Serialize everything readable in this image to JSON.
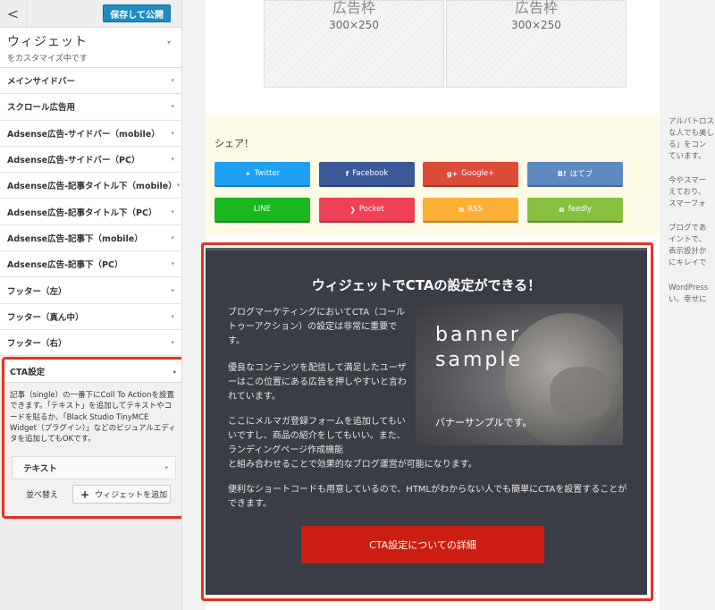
{
  "panel": {
    "back_label": "<",
    "publish_label": "保存して公開",
    "title": "ウィジェット",
    "subtitle": "をカスタマイズ中です",
    "arrow": "▾",
    "sections": [
      "メインサイドバー",
      "スクロール広告用",
      "Adsense広告-サイドバー（mobile）",
      "Adsense広告-サイドバー（PC）",
      "Adsense広告-記事タイトル下（mobile）",
      "Adsense広告-記事タイトル下（PC）",
      "Adsense広告-記事下（mobile）",
      "Adsense広告-記事下（PC）",
      "フッター（左）",
      "フッター（真ん中）",
      "フッター（右）"
    ],
    "cta": {
      "title": "CTA設定",
      "arrow_up": "▴",
      "description": "記事（single）の一番下にColl To Actionを設置できます。「テキスト」を追加してテキストやコードを貼るか、「Black Studio TinyMCE Widget（プラグイン）」などのビジュアルエディタを追加してもOKです。",
      "widget_label": "テキスト",
      "reorder_label": "並べ替え",
      "add_widget_label": "ウィジェットを追加",
      "add_icon": "+"
    }
  },
  "preview": {
    "ads": [
      {
        "label": "広告枠",
        "size": "300×250"
      },
      {
        "label": "広告枠",
        "size": "300×250"
      }
    ],
    "share": {
      "title": "シェア！",
      "buttons": [
        {
          "label": "Twitter",
          "icon": "bird-icon",
          "glyph": "✦",
          "color": "#1ea1f2"
        },
        {
          "label": "Facebook",
          "icon": "f-icon",
          "glyph": "f",
          "color": "#3b5998"
        },
        {
          "label": "Google+",
          "icon": "gplus-icon",
          "glyph": "g+",
          "color": "#dd4b39"
        },
        {
          "label": "はてブ",
          "icon": "b-icon",
          "glyph": "B!",
          "color": "#5d8ac1"
        },
        {
          "label": "LINE",
          "icon": "line-icon",
          "glyph": "",
          "color": "#1bb71f"
        },
        {
          "label": "Pocket",
          "icon": "pocket-icon",
          "glyph": "❯",
          "color": "#ee4056"
        },
        {
          "label": "RSS",
          "icon": "rss-icon",
          "glyph": "⋒",
          "color": "#fbb035"
        },
        {
          "label": "feedly",
          "icon": "feedly-icon",
          "glyph": "⋒",
          "color": "#87c040"
        }
      ]
    },
    "cta": {
      "title": "ウィジェットでCTAの設定ができる！",
      "p1": "ブログマーケティングにおいてCTA（コールトゥーアクション）の設定は非常に重要です。",
      "p2": "優良なコンテンツを配信して満足したユーザーはこの位置にある広告を押しやすいと言われています。",
      "p3a": "ここにメルマガ登録フォームを追加してもいいですし、商品の紹介をしてもいい。また、ランディングページ作成機能",
      "p3b": "と組み合わせることで効果的なブログ運営が可能になります。",
      "p4": "便利なショートコードも用意しているので、HTMLがわからない人でも簡単にCTAを設置することができます。",
      "banner_line1": "banner",
      "banner_line2": "sample",
      "banner_caption": "バナーサンプルです。",
      "button_label": "CTA設定についての詳細"
    },
    "right_column": [
      "アルバトロス",
      "な人でも美し",
      "る」をコン",
      "ています。",
      "今やスマー",
      "えており、",
      "スマーフォ",
      "ブログであ",
      "イントで、",
      "表示設計か",
      "にキレイで",
      "WordPress",
      "い。幸せに"
    ]
  }
}
